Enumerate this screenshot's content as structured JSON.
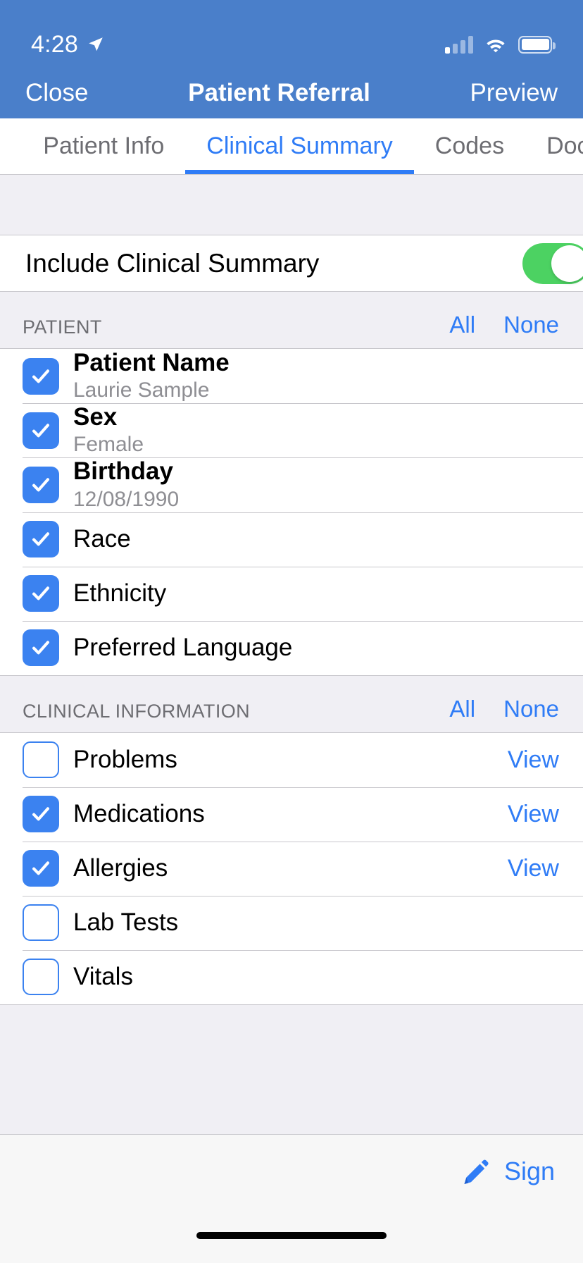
{
  "status_bar": {
    "time": "4:28",
    "location_icon": "location-arrow-icon",
    "signal_icon": "cellular-signal-icon",
    "wifi_icon": "wifi-icon",
    "battery_icon": "battery-icon"
  },
  "nav_bar": {
    "close_label": "Close",
    "title": "Patient Referral",
    "preview_label": "Preview"
  },
  "tabs": [
    {
      "label": "nfo",
      "active": false
    },
    {
      "label": "Patient Info",
      "active": false
    },
    {
      "label": "Clinical Summary",
      "active": true
    },
    {
      "label": "Codes",
      "active": false
    },
    {
      "label": "Docume",
      "active": false
    }
  ],
  "include_toggle": {
    "label": "Include Clinical Summary",
    "value": "on"
  },
  "sections": [
    {
      "title": "PATIENT",
      "all_label": "All",
      "none_label": "None",
      "rows": [
        {
          "title": "Patient Name",
          "subtitle": "Laurie Sample",
          "checked": true,
          "link": ""
        },
        {
          "title": "Sex",
          "subtitle": "Female",
          "checked": true,
          "link": ""
        },
        {
          "title": "Birthday",
          "subtitle": "12/08/1990",
          "checked": true,
          "link": ""
        },
        {
          "title": "Race",
          "subtitle": "",
          "checked": true,
          "link": ""
        },
        {
          "title": "Ethnicity",
          "subtitle": "",
          "checked": true,
          "link": ""
        },
        {
          "title": "Preferred Language",
          "subtitle": "",
          "checked": true,
          "link": ""
        }
      ]
    },
    {
      "title": "CLINICAL INFORMATION",
      "all_label": "All",
      "none_label": "None",
      "rows": [
        {
          "title": "Problems",
          "subtitle": "",
          "checked": false,
          "link": "View"
        },
        {
          "title": "Medications",
          "subtitle": "",
          "checked": true,
          "link": "View"
        },
        {
          "title": "Allergies",
          "subtitle": "",
          "checked": true,
          "link": "View"
        },
        {
          "title": "Lab Tests",
          "subtitle": "",
          "checked": false,
          "link": ""
        },
        {
          "title": "Vitals",
          "subtitle": "",
          "checked": false,
          "link": ""
        }
      ]
    }
  ],
  "bottom_bar": {
    "sign_label": "Sign",
    "sign_icon": "pen-icon"
  },
  "colors": {
    "nav_background": "#4a7fca",
    "accent_blue": "#2f7cf6",
    "checkbox_blue": "#3b82f0",
    "toggle_green": "#4cd262",
    "group_background": "#f0eff4"
  }
}
